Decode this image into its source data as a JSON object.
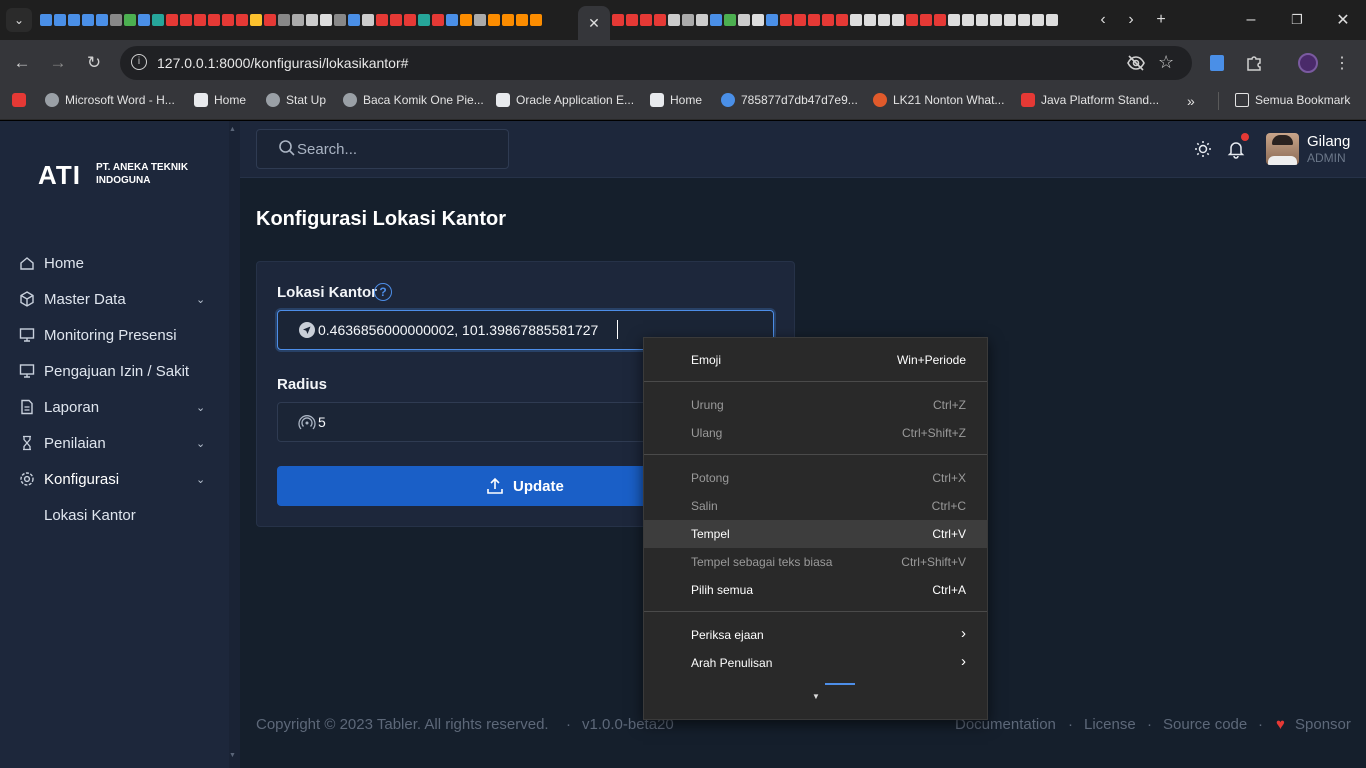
{
  "browser": {
    "url": "127.0.0.1:8000/konfigurasi/lokasikantor#",
    "bookmarks": [
      {
        "label": "Microsoft Word - H...",
        "color": "#9aa0a6"
      },
      {
        "label": "Home",
        "color": "#e8eaed"
      },
      {
        "label": "Stat Up",
        "color": "#9aa0a6"
      },
      {
        "label": "Baca Komik One Pie...",
        "color": "#9aa0a6"
      },
      {
        "label": "Oracle Application E...",
        "color": "#e8eaed"
      },
      {
        "label": "Home",
        "color": "#e8eaed"
      },
      {
        "label": "785877d7db47d7e9...",
        "color": "#4a8fe7"
      },
      {
        "label": "LK21 Nonton What...",
        "color": "#e05a2b"
      },
      {
        "label": "Java Platform Stand...",
        "color": "#e53935"
      }
    ],
    "all_bookmarks_label": "Semua Bookmark"
  },
  "brand": {
    "logo_text": "ATI",
    "company_line1": "PT. ANEKA TEKNIK",
    "company_line2": "INDOGUNA"
  },
  "search": {
    "placeholder": "Search..."
  },
  "user": {
    "name": "Gilang",
    "role": "ADMIN"
  },
  "sidebar": {
    "items": [
      {
        "label": "Home",
        "icon": "home-icon"
      },
      {
        "label": "Master Data",
        "icon": "package-icon",
        "chevron": true
      },
      {
        "label": "Monitoring Presensi",
        "icon": "monitor-icon"
      },
      {
        "label": "Pengajuan Izin / Sakit",
        "icon": "monitor-icon"
      },
      {
        "label": "Laporan",
        "icon": "file-icon",
        "chevron": true
      },
      {
        "label": "Penilaian",
        "icon": "hourglass-icon",
        "chevron": true
      },
      {
        "label": "Konfigurasi",
        "icon": "gear-icon",
        "chevron": true
      },
      {
        "label": "Lokasi Kantor"
      }
    ]
  },
  "page": {
    "title": "Konfigurasi Lokasi Kantor",
    "lokasi_label": "Lokasi Kantor",
    "lokasi_value": "0.4636856000000002, 101.39867885581727",
    "radius_label": "Radius",
    "radius_value": "5",
    "update_label": "Update"
  },
  "footer": {
    "copyright": "Copyright © 2023 Tabler. All rights reserved.",
    "version": "v1.0.0-beta20",
    "links": [
      "Documentation",
      "License",
      "Source code",
      "Sponsor"
    ]
  },
  "context_menu": {
    "items": [
      {
        "label": "Emoji",
        "shortcut": "Win+Periode",
        "enabled": true
      },
      {
        "label": "Urung",
        "shortcut": "Ctrl+Z",
        "enabled": false
      },
      {
        "label": "Ulang",
        "shortcut": "Ctrl+Shift+Z",
        "enabled": false
      },
      {
        "label": "Potong",
        "shortcut": "Ctrl+X",
        "enabled": false
      },
      {
        "label": "Salin",
        "shortcut": "Ctrl+C",
        "enabled": false
      },
      {
        "label": "Tempel",
        "shortcut": "Ctrl+V",
        "enabled": true,
        "highlighted": true
      },
      {
        "label": "Tempel sebagai teks biasa",
        "shortcut": "Ctrl+Shift+V",
        "enabled": false
      },
      {
        "label": "Pilih semua",
        "shortcut": "Ctrl+A",
        "enabled": true
      },
      {
        "label": "Periksa ejaan",
        "shortcut": "›",
        "enabled": true
      },
      {
        "label": "Arah Penulisan",
        "shortcut": "›",
        "enabled": true
      }
    ]
  },
  "colors": {
    "accent": "#1a5fc7",
    "sidebar_bg": "#1d273b",
    "page_bg": "#151f2c",
    "notification_dot": "#e53935"
  }
}
